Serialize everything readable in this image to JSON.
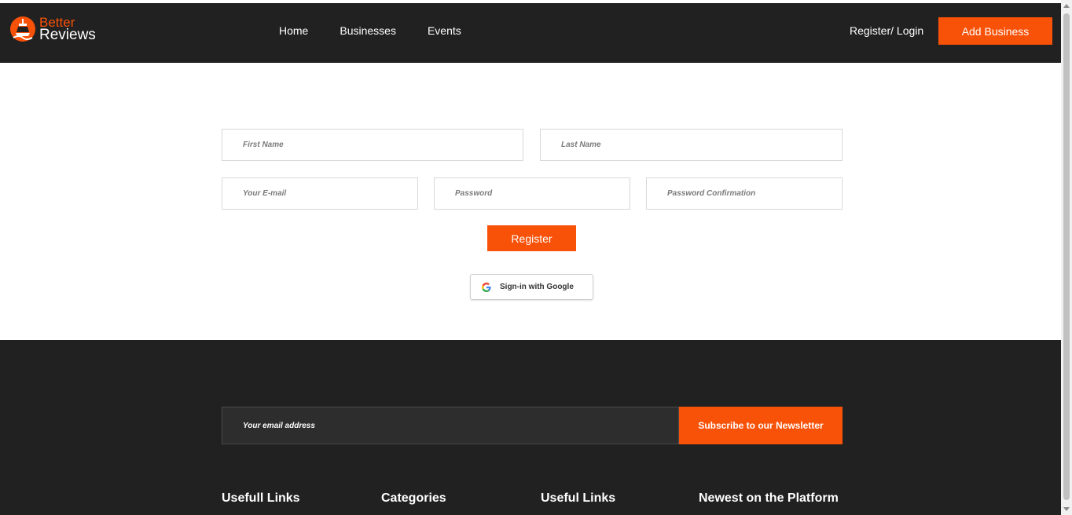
{
  "header": {
    "logo": {
      "line1": "Better",
      "line2": "Reviews"
    },
    "nav": [
      "Home",
      "Businesses",
      "Events"
    ],
    "register_login": "Register/ Login",
    "add_business": "Add Business"
  },
  "form": {
    "first_name_placeholder": "First Name",
    "last_name_placeholder": "Last Name",
    "email_placeholder": "Your E-mail",
    "password_placeholder": "Password",
    "password_confirm_placeholder": "Password Confirmation",
    "register_label": "Register",
    "google_label": "Sign-in with Google"
  },
  "footer": {
    "newsletter_placeholder": "Your email address",
    "subscribe_label": "Subscribe to our Newsletter",
    "columns": [
      "Usefull Links",
      "Categories",
      "Useful Links",
      "Newest on the Platform"
    ]
  },
  "colors": {
    "accent": "#f85108",
    "dark": "#212121"
  }
}
